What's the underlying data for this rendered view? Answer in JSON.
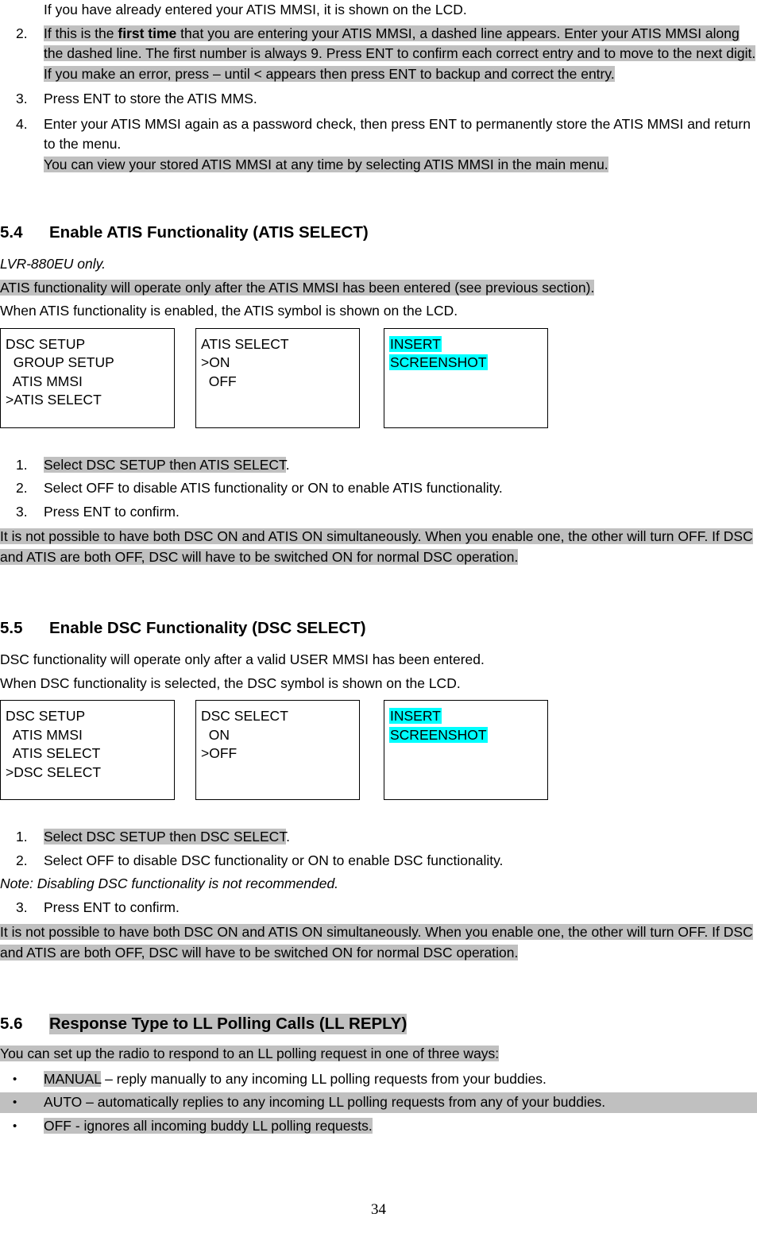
{
  "colors": {
    "highlight_gray": "#c0c0c0",
    "highlight_cyan": "#00ffff",
    "text": "#000000",
    "background": "#ffffff"
  },
  "top_steps": {
    "intro": "If you have already entered your ATIS MMSI, it is shown on the LCD.",
    "item2": {
      "marker": "2.",
      "part_a": "If this is the ",
      "part_b_bold": "first time",
      "part_c": " that you are entering your ATIS MMSI, a dashed line appears.  Enter your ATIS MMSI along the dashed line. The first number is always 9.",
      "part_d": " Press ENT to confirm each correct entry and to move to the next digit.",
      "sub_note": "If you make an error, press – until < appears then press ENT to backup and correct the entry."
    },
    "item3": {
      "marker": "3.",
      "text": "Press ENT to store the ATIS MMS."
    },
    "item4": {
      "marker": "4.",
      "text": "Enter your ATIS MMSI again as a password check, then press ENT to permanently store the ATIS MMSI and return to the menu.",
      "sub_note": "You can view your stored ATIS MMSI at any time by selecting ATIS MMSI in the main menu."
    }
  },
  "section_54": {
    "number": "5.4",
    "title": "Enable ATIS Functionality (ATIS SELECT)",
    "model_note": "LVR-880EU only.",
    "prereq": "ATIS functionality will operate only after the ATIS MMSI has been entered (see previous section).",
    "symbol_note": "When ATIS functionality is enabled, the ATIS symbol is shown on the LCD.",
    "lcd_boxes": [
      {
        "name": "dsc-setup-menu",
        "lines": [
          "DSC SETUP",
          "  GROUP SETUP",
          "  ATIS MMSI",
          ">ATIS SELECT"
        ]
      },
      {
        "name": "atis-select-menu",
        "lines": [
          "ATIS SELECT",
          ">ON",
          "  OFF",
          ""
        ]
      },
      {
        "name": "screenshot-placeholder",
        "lines": [
          "INSERT",
          "SCREENSHOT",
          "",
          ""
        ],
        "highlight": "cyan"
      }
    ],
    "steps": [
      {
        "marker": "1.",
        "highlighted": "Select DSC SETUP then ATIS SELECT",
        "tail": "."
      },
      {
        "marker": "2.",
        "plain": "Select OFF to disable ATIS functionality or ON to enable ATIS functionality."
      },
      {
        "marker": "3.",
        "plain": "Press ENT to confirm."
      }
    ],
    "warning": "It is not possible to have both DSC ON and ATIS ON simultaneously. When you enable one, the other will turn OFF. If DSC and ATIS are both OFF, DSC will have to be switched ON for normal DSC operation."
  },
  "section_55": {
    "number": "5.5",
    "title": "Enable DSC Functionality (DSC SELECT)",
    "prereq": "DSC functionality will operate only after a valid USER MMSI has been entered.",
    "symbol_note": "When DSC functionality is selected, the DSC symbol is shown on the LCD.",
    "lcd_boxes": [
      {
        "name": "dsc-setup-menu",
        "lines": [
          "DSC SETUP",
          "  ATIS MMSI",
          "  ATIS SELECT",
          ">DSC SELECT"
        ]
      },
      {
        "name": "dsc-select-menu",
        "lines": [
          "DSC SELECT",
          "  ON",
          ">OFF",
          ""
        ]
      },
      {
        "name": "screenshot-placeholder",
        "lines": [
          "INSERT",
          "SCREENSHOT",
          "",
          ""
        ],
        "highlight": "cyan"
      }
    ],
    "steps": [
      {
        "marker": "1.",
        "highlighted": "Select DSC SETUP then DSC SELECT",
        "tail": "."
      },
      {
        "marker": "2.",
        "plain": "Select OFF to disable DSC functionality or ON to enable DSC functionality."
      }
    ],
    "note": "Note: Disabling DSC functionality is not recommended.",
    "step3": {
      "marker": "3.",
      "plain": "Press ENT to confirm."
    },
    "warning": "It is not possible to have both DSC ON and ATIS ON simultaneously. When you enable one, the other will turn OFF. If DSC and ATIS are both OFF, DSC will have to be switched ON for normal DSC operation."
  },
  "section_56": {
    "number": "5.6",
    "title": "Response Type to LL Polling Calls (LL REPLY)",
    "intro": "You can set up the radio to respond to an LL polling request in one of three ways:",
    "bullets": [
      {
        "marker": "•",
        "key": "MANUAL",
        "rest": " – reply manually to any incoming LL polling requests from your buddies."
      },
      {
        "marker": "•",
        "full": "AUTO – automatically replies to any incoming LL polling requests from any of your buddies."
      },
      {
        "marker": "•",
        "full": "OFF - ignores all incoming buddy LL polling requests."
      }
    ]
  },
  "footer": {
    "page_number": "34"
  }
}
